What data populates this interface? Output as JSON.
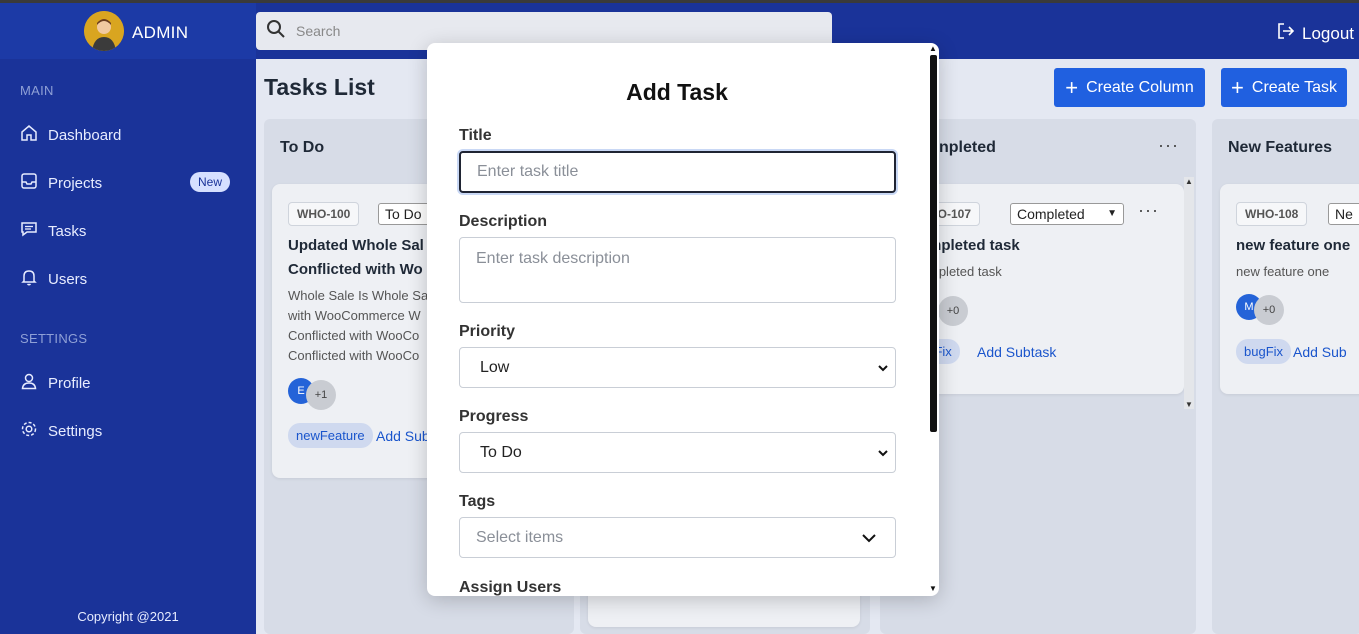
{
  "topbar": {
    "brand": "ADMIN",
    "search_placeholder": "Search",
    "logout_label": "Logout"
  },
  "sidebar": {
    "main_section": "MAIN",
    "settings_section": "SETTINGS",
    "items": [
      {
        "label": "Dashboard",
        "icon": "home-icon"
      },
      {
        "label": "Projects",
        "icon": "inbox-icon",
        "badge": "New"
      },
      {
        "label": "Tasks",
        "icon": "chat-icon"
      },
      {
        "label": "Users",
        "icon": "bell-icon"
      },
      {
        "label": "Profile",
        "icon": "user-icon"
      },
      {
        "label": "Settings",
        "icon": "gear-icon"
      }
    ],
    "copyright": "Copyright @2021"
  },
  "main": {
    "title": "Tasks List",
    "create_column": "Create Column",
    "create_task": "Create Task",
    "columns": [
      {
        "name": "To Do",
        "card": {
          "id": "WHO-100",
          "status": "To Do",
          "title_line1": "Updated Whole Sal",
          "title_line2": "Conflicted with Wo",
          "desc_lines": [
            "Whole Sale Is Whole Sa",
            "with WooCommerce W",
            "Conflicted with WooCo",
            "Conflicted with WooCo"
          ],
          "avatar": "E",
          "more_users": "+1",
          "tag": "newFeature",
          "add_subtask": "Add Sub"
        }
      },
      {
        "name": "npleted",
        "card": {
          "id": "HO-107",
          "status": "Completed",
          "title": "mpleted task",
          "desc": "mpleted task",
          "more_users": "+0",
          "tag": "ugFix",
          "add_subtask": "Add Subtask"
        }
      },
      {
        "name": "New Features",
        "card": {
          "id": "WHO-108",
          "status": "Ne",
          "title": "new feature one",
          "desc": "new feature one",
          "avatar": "M",
          "more_users": "+0",
          "tag": "bugFix",
          "add_subtask": "Add Sub"
        }
      }
    ]
  },
  "modal": {
    "title": "Add Task",
    "title_label": "Title",
    "title_placeholder": "Enter task title",
    "description_label": "Description",
    "description_placeholder": "Enter task description",
    "priority_label": "Priority",
    "priority_value": "Low",
    "progress_label": "Progress",
    "progress_value": "To Do",
    "tags_label": "Tags",
    "tags_placeholder": "Select items",
    "assign_label": "Assign Users"
  },
  "colors": {
    "sidebar": "#1a3399",
    "accent": "#2060e0",
    "tag_bg": "#cfd9ef"
  }
}
